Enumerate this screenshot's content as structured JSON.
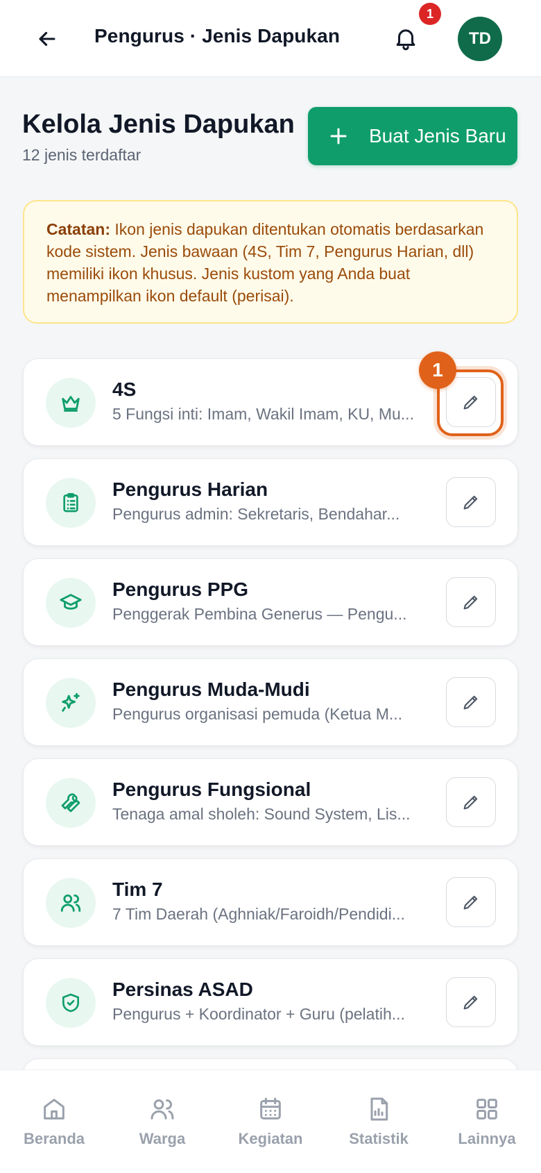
{
  "header": {
    "title": "Pengurus · Jenis Dapukan",
    "notification_count": "1",
    "avatar_initials": "TD"
  },
  "page": {
    "heading": "Kelola Jenis Dapukan",
    "subtitle": "12 jenis terdaftar",
    "create_button_label": "Buat Jenis Baru"
  },
  "note": {
    "label": "Catatan:",
    "text": " Ikon jenis dapukan ditentukan otomatis berdasarkan kode sistem. Jenis bawaan (4S, Tim 7, Pengurus Harian, dll) memiliki ikon khusus. Jenis kustom yang Anda buat menampilkan ikon default (perisai)."
  },
  "step_badge": "1",
  "types": [
    {
      "name": "4S",
      "description": "5 Fungsi inti: Imam, Wakil Imam, KU, Mu...",
      "icon": "crown-icon"
    },
    {
      "name": "Pengurus Harian",
      "description": "Pengurus admin: Sekretaris, Bendahar...",
      "icon": "clipboard-icon"
    },
    {
      "name": "Pengurus PPG",
      "description": "Penggerak Pembina Generus — Pengu...",
      "icon": "graduation-cap-icon"
    },
    {
      "name": "Pengurus Muda-Mudi",
      "description": "Pengurus organisasi pemuda (Ketua M...",
      "icon": "sparkles-icon"
    },
    {
      "name": "Pengurus Fungsional",
      "description": "Tenaga amal sholeh: Sound System, Lis...",
      "icon": "wrench-icon"
    },
    {
      "name": "Tim 7",
      "description": "7 Tim Daerah (Aghniak/Faroidh/Pendidi...",
      "icon": "users-icon"
    },
    {
      "name": "Persinas ASAD",
      "description": "Pengurus + Koordinator + Guru (pelatih...",
      "icon": "shield-icon"
    }
  ],
  "bottom_nav": [
    {
      "label": "Beranda",
      "icon": "home-icon"
    },
    {
      "label": "Warga",
      "icon": "users-icon"
    },
    {
      "label": "Kegiatan",
      "icon": "calendar-icon"
    },
    {
      "label": "Statistik",
      "icon": "report-chart-icon"
    },
    {
      "label": "Lainnya",
      "icon": "grid-icon"
    }
  ],
  "colors": {
    "primary": "#0f9e6b",
    "icon_bg": "#e8f7f0",
    "note_bg": "#fffbea",
    "note_text": "#9a4b0a",
    "highlight": "#e0621a",
    "badge": "#dc2626"
  }
}
